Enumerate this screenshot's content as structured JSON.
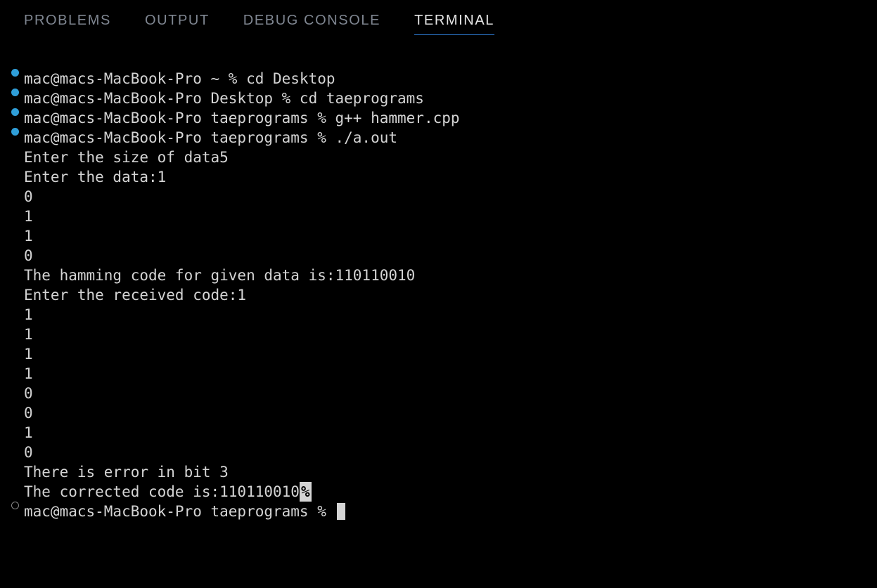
{
  "tabs": {
    "problems": "PROBLEMS",
    "output": "OUTPUT",
    "debug_console": "DEBUG CONSOLE",
    "terminal": "TERMINAL",
    "active": "terminal"
  },
  "terminal": {
    "bulleted": [
      "mac@macs-MacBook-Pro ~ % cd Desktop",
      "mac@macs-MacBook-Pro Desktop % cd taeprograms",
      "mac@macs-MacBook-Pro taeprograms % g++ hammer.cpp",
      "mac@macs-MacBook-Pro taeprograms % ./a.out"
    ],
    "output": [
      "",
      "Enter the size of data5",
      "Enter the data:1",
      "0",
      "1",
      "1",
      "0",
      "The hamming code for given data is:110110010",
      "Enter the received code:1",
      "1",
      "1",
      "1",
      "1",
      "0",
      "0",
      "1",
      "0",
      "",
      "There is error in bit 3"
    ],
    "corrected_prefix": "The corrected code is:110110010",
    "percent": "%",
    "prompt_tail": "mac@macs-MacBook-Pro taeprograms % "
  }
}
